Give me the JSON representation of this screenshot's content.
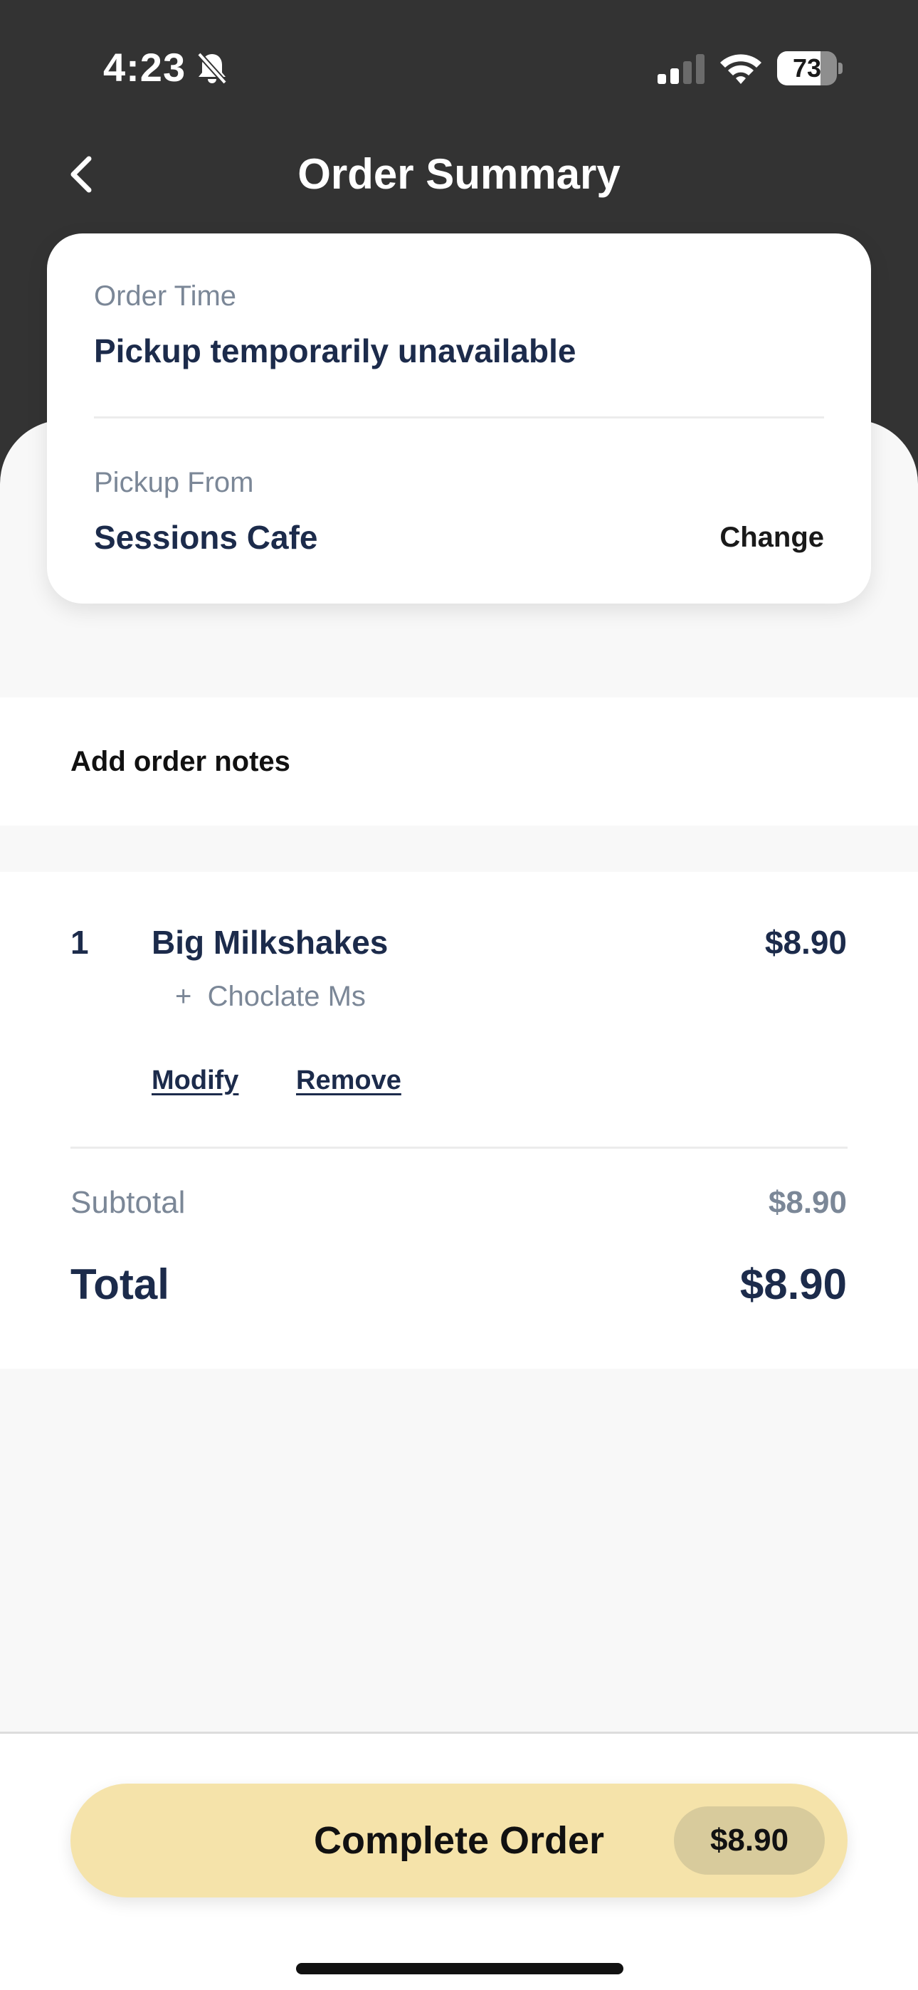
{
  "status_bar": {
    "time": "4:23",
    "battery_level": "73",
    "battery_fraction": 0.73,
    "icons": [
      "bell-off-icon",
      "signal-icon",
      "wifi-icon",
      "battery-icon"
    ]
  },
  "nav": {
    "title": "Order Summary",
    "back_icon": "chevron-left-icon"
  },
  "order_info": {
    "order_time_label": "Order Time",
    "order_time_value": "Pickup temporarily unavailable",
    "pickup_from_label": "Pickup From",
    "pickup_from_value": "Sessions Cafe",
    "change_label": "Change"
  },
  "notes": {
    "label": "Add order notes"
  },
  "items": [
    {
      "quantity": "1",
      "name": "Big Milkshakes",
      "price": "$8.90",
      "modifier": "+  Choclate Ms",
      "modify_label": "Modify",
      "remove_label": "Remove"
    }
  ],
  "totals": {
    "subtotal_label": "Subtotal",
    "subtotal_value": "$8.90",
    "total_label": "Total",
    "total_value": "$8.90"
  },
  "footer": {
    "button_label": "Complete Order",
    "button_price": "$8.90"
  },
  "colors": {
    "header_bg": "#333333",
    "body_bg": "#f8f8f8",
    "primary_text": "#1c2b4b",
    "secondary_text": "#7b8797",
    "button_bg": "#f5e3aa",
    "button_price_bg": "#d8cb9c"
  }
}
